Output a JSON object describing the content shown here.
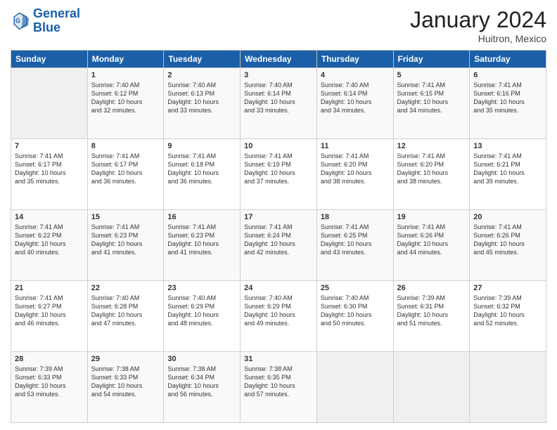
{
  "header": {
    "logo_line1": "General",
    "logo_line2": "Blue",
    "month": "January 2024",
    "location": "Huitron, Mexico"
  },
  "days_of_week": [
    "Sunday",
    "Monday",
    "Tuesday",
    "Wednesday",
    "Thursday",
    "Friday",
    "Saturday"
  ],
  "weeks": [
    [
      {
        "day": "",
        "info": ""
      },
      {
        "day": "1",
        "info": "Sunrise: 7:40 AM\nSunset: 6:12 PM\nDaylight: 10 hours\nand 32 minutes."
      },
      {
        "day": "2",
        "info": "Sunrise: 7:40 AM\nSunset: 6:13 PM\nDaylight: 10 hours\nand 33 minutes."
      },
      {
        "day": "3",
        "info": "Sunrise: 7:40 AM\nSunset: 6:14 PM\nDaylight: 10 hours\nand 33 minutes."
      },
      {
        "day": "4",
        "info": "Sunrise: 7:40 AM\nSunset: 6:14 PM\nDaylight: 10 hours\nand 34 minutes."
      },
      {
        "day": "5",
        "info": "Sunrise: 7:41 AM\nSunset: 6:15 PM\nDaylight: 10 hours\nand 34 minutes."
      },
      {
        "day": "6",
        "info": "Sunrise: 7:41 AM\nSunset: 6:16 PM\nDaylight: 10 hours\nand 35 minutes."
      }
    ],
    [
      {
        "day": "7",
        "info": "Sunrise: 7:41 AM\nSunset: 6:17 PM\nDaylight: 10 hours\nand 35 minutes."
      },
      {
        "day": "8",
        "info": "Sunrise: 7:41 AM\nSunset: 6:17 PM\nDaylight: 10 hours\nand 36 minutes."
      },
      {
        "day": "9",
        "info": "Sunrise: 7:41 AM\nSunset: 6:18 PM\nDaylight: 10 hours\nand 36 minutes."
      },
      {
        "day": "10",
        "info": "Sunrise: 7:41 AM\nSunset: 6:19 PM\nDaylight: 10 hours\nand 37 minutes."
      },
      {
        "day": "11",
        "info": "Sunrise: 7:41 AM\nSunset: 6:20 PM\nDaylight: 10 hours\nand 38 minutes."
      },
      {
        "day": "12",
        "info": "Sunrise: 7:41 AM\nSunset: 6:20 PM\nDaylight: 10 hours\nand 38 minutes."
      },
      {
        "day": "13",
        "info": "Sunrise: 7:41 AM\nSunset: 6:21 PM\nDaylight: 10 hours\nand 39 minutes."
      }
    ],
    [
      {
        "day": "14",
        "info": "Sunrise: 7:41 AM\nSunset: 6:22 PM\nDaylight: 10 hours\nand 40 minutes."
      },
      {
        "day": "15",
        "info": "Sunrise: 7:41 AM\nSunset: 6:23 PM\nDaylight: 10 hours\nand 41 minutes."
      },
      {
        "day": "16",
        "info": "Sunrise: 7:41 AM\nSunset: 6:23 PM\nDaylight: 10 hours\nand 41 minutes."
      },
      {
        "day": "17",
        "info": "Sunrise: 7:41 AM\nSunset: 6:24 PM\nDaylight: 10 hours\nand 42 minutes."
      },
      {
        "day": "18",
        "info": "Sunrise: 7:41 AM\nSunset: 6:25 PM\nDaylight: 10 hours\nand 43 minutes."
      },
      {
        "day": "19",
        "info": "Sunrise: 7:41 AM\nSunset: 6:26 PM\nDaylight: 10 hours\nand 44 minutes."
      },
      {
        "day": "20",
        "info": "Sunrise: 7:41 AM\nSunset: 6:26 PM\nDaylight: 10 hours\nand 45 minutes."
      }
    ],
    [
      {
        "day": "21",
        "info": "Sunrise: 7:41 AM\nSunset: 6:27 PM\nDaylight: 10 hours\nand 46 minutes."
      },
      {
        "day": "22",
        "info": "Sunrise: 7:40 AM\nSunset: 6:28 PM\nDaylight: 10 hours\nand 47 minutes."
      },
      {
        "day": "23",
        "info": "Sunrise: 7:40 AM\nSunset: 6:29 PM\nDaylight: 10 hours\nand 48 minutes."
      },
      {
        "day": "24",
        "info": "Sunrise: 7:40 AM\nSunset: 6:29 PM\nDaylight: 10 hours\nand 49 minutes."
      },
      {
        "day": "25",
        "info": "Sunrise: 7:40 AM\nSunset: 6:30 PM\nDaylight: 10 hours\nand 50 minutes."
      },
      {
        "day": "26",
        "info": "Sunrise: 7:39 AM\nSunset: 6:31 PM\nDaylight: 10 hours\nand 51 minutes."
      },
      {
        "day": "27",
        "info": "Sunrise: 7:39 AM\nSunset: 6:32 PM\nDaylight: 10 hours\nand 52 minutes."
      }
    ],
    [
      {
        "day": "28",
        "info": "Sunrise: 7:39 AM\nSunset: 6:33 PM\nDaylight: 10 hours\nand 53 minutes."
      },
      {
        "day": "29",
        "info": "Sunrise: 7:38 AM\nSunset: 6:33 PM\nDaylight: 10 hours\nand 54 minutes."
      },
      {
        "day": "30",
        "info": "Sunrise: 7:38 AM\nSunset: 6:34 PM\nDaylight: 10 hours\nand 56 minutes."
      },
      {
        "day": "31",
        "info": "Sunrise: 7:38 AM\nSunset: 6:35 PM\nDaylight: 10 hours\nand 57 minutes."
      },
      {
        "day": "",
        "info": ""
      },
      {
        "day": "",
        "info": ""
      },
      {
        "day": "",
        "info": ""
      }
    ]
  ]
}
